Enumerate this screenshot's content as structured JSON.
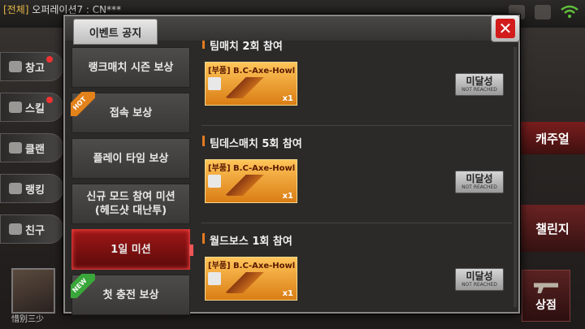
{
  "chat": {
    "channel": "[전체]",
    "message": "오퍼레이션7 : CN***"
  },
  "left_menu": [
    {
      "label": "창고",
      "dot": true
    },
    {
      "label": "스킬",
      "dot": true
    },
    {
      "label": "클랜",
      "dot": false
    },
    {
      "label": "랭킹",
      "dot": false
    },
    {
      "label": "친구",
      "dot": false
    }
  ],
  "player": {
    "name": "惜别三少"
  },
  "right_panel": {
    "casual": "캐주얼",
    "challenge": "챌린지",
    "shop": "상점"
  },
  "dialog": {
    "title": "이벤트 공지",
    "close_label": "✕",
    "tabs": [
      {
        "label": "랭크매치 시즌 보상",
        "badge": ""
      },
      {
        "label": "접속 보상",
        "badge": "HOT"
      },
      {
        "label": "플레이 타임 보상",
        "badge": ""
      },
      {
        "label": "신규 모드 참여 미션\n(헤드샷 대난투)",
        "badge": ""
      },
      {
        "label": "1일 미션",
        "badge": "",
        "active": true
      },
      {
        "label": "첫 충전 보상",
        "badge": "NEW"
      }
    ],
    "missions": [
      {
        "title": "팀매치 2회 참여",
        "reward": "[부품] B.C-Axe-Howl",
        "qty": "x1",
        "status": "미달성",
        "status_sub": "NOT REACHED"
      },
      {
        "title": "팀데스매치 5회 참여",
        "reward": "[부품] B.C-Axe-Howl",
        "qty": "x1",
        "status": "미달성",
        "status_sub": "NOT REACHED"
      },
      {
        "title": "월드보스 1회 참여",
        "reward": "[부품] B.C-Axe-Howl",
        "qty": "x1",
        "status": "미달성",
        "status_sub": "NOT REACHED"
      }
    ]
  }
}
